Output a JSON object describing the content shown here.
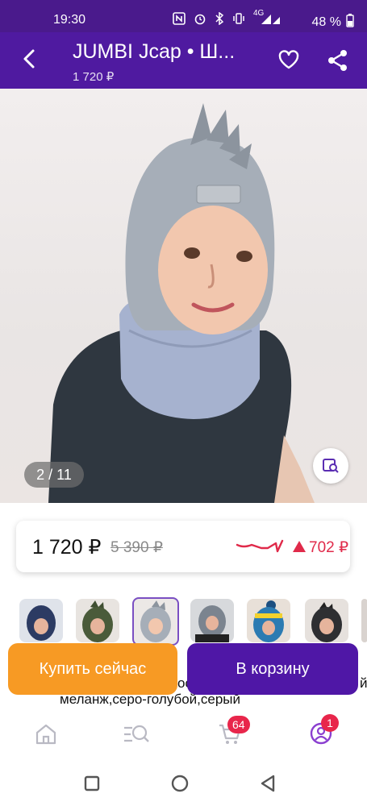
{
  "status_bar": {
    "time": "19:30",
    "battery_text": "48 %",
    "network_label": "4G",
    "icons": [
      "nfc-icon",
      "alarm-icon",
      "bluetooth-icon",
      "vibrate-icon",
      "signal-icon",
      "battery-icon"
    ]
  },
  "header": {
    "title": "JUMBI Jcap • Ш...",
    "subtitle": "1 720 ₽",
    "icons": [
      "back-arrow-icon",
      "heart-icon",
      "share-icon"
    ]
  },
  "gallery": {
    "counter": "2 / 11",
    "zoom_icon": "image-search-icon",
    "thumbnail_count": 7,
    "selected_thumbnail": 3
  },
  "price_card": {
    "price": "1 720 ₽",
    "old_price": "5 390 ₽",
    "delta": "702 ₽",
    "trend_icon": "price-trend-icon",
    "delta_icon": "up-triangle-icon"
  },
  "actions": {
    "buy_now": "Купить сейчас",
    "add_to_cart": "В корзину"
  },
  "description": {
    "line_top_left": "ос",
    "line_top_right": "й",
    "line": "меланж,серо-голубой,серый"
  },
  "tabbar": {
    "icons": [
      "home-icon",
      "catalog-search-icon",
      "cart-icon",
      "profile-icon"
    ],
    "cart_badge": "64",
    "profile_badge": "1"
  },
  "system_nav": {
    "icons": [
      "recents-icon",
      "home-circle-icon",
      "back-triangle-icon"
    ]
  },
  "colors": {
    "header": "#4f1aa0",
    "buy_now": "#f79a24",
    "add_to_cart": "#4f17a6",
    "delta": "#e02a4a",
    "badge": "#e8264b"
  }
}
